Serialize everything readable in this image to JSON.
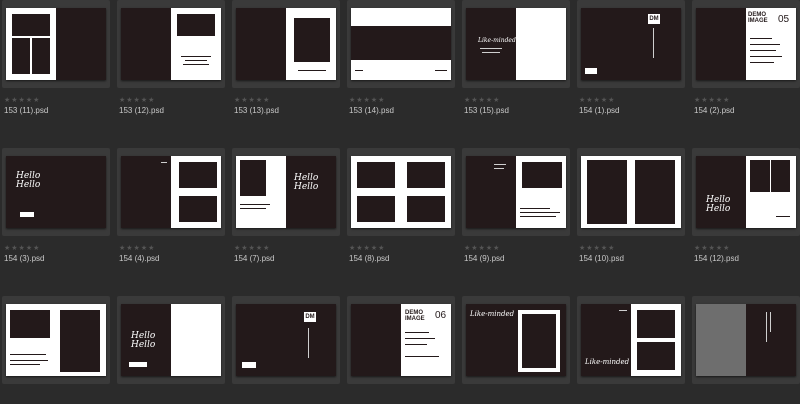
{
  "rows": [
    {
      "items": [
        {
          "name": "153 (11).psd",
          "stars": "★★★★★"
        },
        {
          "name": "153 (12).psd",
          "stars": "★★★★★"
        },
        {
          "name": "153 (13).psd",
          "stars": "★★★★★"
        },
        {
          "name": "153 (14).psd",
          "stars": "★★★★★"
        },
        {
          "name": "153 (15).psd",
          "stars": "★★★★★"
        },
        {
          "name": "154 (1).psd",
          "stars": "★★★★★"
        },
        {
          "name": "154 (2).psd",
          "stars": "★★★★★"
        }
      ]
    },
    {
      "items": [
        {
          "name": "154 (3).psd",
          "stars": "★★★★★"
        },
        {
          "name": "154 (4).psd",
          "stars": "★★★★★"
        },
        {
          "name": "154 (7).psd",
          "stars": "★★★★★"
        },
        {
          "name": "154 (8).psd",
          "stars": "★★★★★"
        },
        {
          "name": "154 (9).psd",
          "stars": "★★★★★"
        },
        {
          "name": "154 (10).psd",
          "stars": "★★★★★"
        },
        {
          "name": "154 (12).psd",
          "stars": "★★★★★"
        }
      ]
    },
    {
      "items": [
        {
          "name": "",
          "stars": ""
        },
        {
          "name": "",
          "stars": ""
        },
        {
          "name": "",
          "stars": ""
        },
        {
          "name": "",
          "stars": ""
        },
        {
          "name": "",
          "stars": ""
        },
        {
          "name": "",
          "stars": ""
        },
        {
          "name": "",
          "stars": ""
        }
      ]
    }
  ],
  "thumb_text": {
    "demo_image": "DEMO IMAGE",
    "dm": "DM",
    "like_minded": "Like-minded",
    "hello_hello": "Hello Hello",
    "like_minded_small": "Like-minded",
    "num_05": "05",
    "num_06": "06"
  },
  "colors": {
    "background": "#2b2b2b",
    "tile": "#3a3a3a",
    "dark_page": "#23191a",
    "label": "#c9c9c9"
  }
}
